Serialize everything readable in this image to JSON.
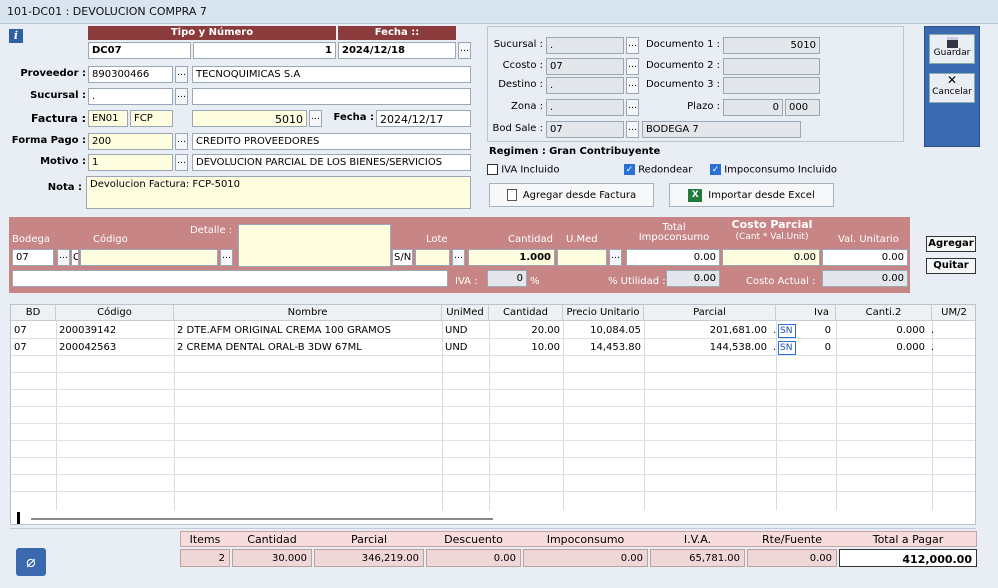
{
  "window": {
    "title": "101-DC01 : DEVOLUCION COMPRA 7"
  },
  "header": {
    "tipo_numero_label": "Tipo y Número",
    "fecha_label": "Fecha ::",
    "tipo": "DC07",
    "numero": "1",
    "fecha": "2024/12/18",
    "proveedor_label": "Proveedor :",
    "proveedor_code": "890300466",
    "proveedor_name": "TECNOQUIMICAS S.A",
    "sucursal_label": "Sucursal :",
    "sucursal_value": ".",
    "sucursal_name": "",
    "factura_label": "Factura :",
    "factura_pref": "EN01",
    "factura_tipo": "FCP",
    "factura_num": "5010",
    "factura_fecha_label": "Fecha :",
    "factura_fecha": "2024/12/17",
    "forma_pago_label": "Forma Pago :",
    "forma_pago_code": "200",
    "forma_pago_name": "CREDITO PROVEEDORES",
    "motivo_label": "Motivo :",
    "motivo_code": "1",
    "motivo_name": "DEVOLUCION PARCIAL DE LOS BIENES/SERVICIOS",
    "nota_label": "Nota :",
    "nota": "Devolucion Factura: FCP-5010"
  },
  "right": {
    "sucursal_label": "Sucursal :",
    "sucursal": ".",
    "ccosto_label": "Ccosto :",
    "ccosto": "07",
    "destino_label": "Destino :",
    "destino": ".",
    "zona_label": "Zona :",
    "zona": ".",
    "bodsale_label": "Bod Sale :",
    "bodsale": "07",
    "bodsale_name": "BODEGA 7",
    "doc1_label": "Documento 1 :",
    "doc1": "5010",
    "doc2_label": "Documento 2 :",
    "doc2": "",
    "doc3_label": "Documento 3 :",
    "doc3": "",
    "plazo_label": "Plazo :",
    "plazo1": "0",
    "plazo2": "000",
    "regimen_label": "Regimen :",
    "regimen": "Gran Contribuyente",
    "iva_incluido": "IVA Incluido",
    "redondear": "Redondear",
    "impoconsumo": "Impoconsumo Incluido",
    "agregar_factura": "Agregar desde Factura",
    "importar_excel": "Importar desde Excel"
  },
  "actions": {
    "guardar": "Guardar",
    "cancelar": "Cancelar"
  },
  "entry": {
    "bodega_label": "Bodega",
    "codigo_label": "Código",
    "detalle_label": "Detalle :",
    "lote_label": "Lote",
    "cantidad_label": "Cantidad",
    "umed_label": "U.Med",
    "total_impo_label1": "Total",
    "total_impo_label2": "Impoconsumo",
    "costo_parcial_label": "Costo Parcial",
    "costo_parcial_sub": "(Cant * Val.Unit)",
    "val_unit_label": "Val. Unitario",
    "bodega": "07",
    "codigo": "C",
    "sn": "S/N",
    "cantidad": "1.000",
    "total_impo": "0.00",
    "costo_parcial": "0.00",
    "val_unit": "0.00",
    "iva_label": "IVA :",
    "iva": "0",
    "pct": "%",
    "utilidad_label": "% Utilidad :",
    "utilidad": "0.00",
    "costo_actual_label": "Costo Actual :",
    "costo_actual": "0.00",
    "agregar": "Agregar",
    "quitar": "Quitar"
  },
  "grid": {
    "columns": [
      "BD",
      "Código",
      "Nombre",
      "UniMed",
      "Cantidad",
      "Precio Unitario",
      "Parcial",
      "Iva",
      "Canti.2",
      "UM/2"
    ],
    "rows": [
      {
        "bd": "07",
        "codigo": "200039142",
        "nombre": "2 DTE.AFM ORIGINAL CREMA 100 GRAMOS",
        "unimed": "UND",
        "cantidad": "20.00",
        "precio": "10,084.05",
        "parcial": "201,681.00",
        "flag": ".",
        "sn": "SN",
        "iva": "0",
        "canti2": "0.000",
        "um2": "."
      },
      {
        "bd": "07",
        "codigo": "200042563",
        "nombre": "2 CREMA DENTAL ORAL-B 3DW 67ML",
        "unimed": "UND",
        "cantidad": "10.00",
        "precio": "14,453.80",
        "parcial": "144,538.00",
        "flag": ".",
        "sn": "SN",
        "iva": "0",
        "canti2": "0.000",
        "um2": "."
      }
    ]
  },
  "totals": {
    "labels": [
      "Items",
      "Cantidad",
      "Parcial",
      "Descuento",
      "Impoconsumo",
      "I.V.A.",
      "Rte/Fuente",
      "Total a Pagar"
    ],
    "values": [
      "2",
      "30.000",
      "346,219.00",
      "0.00",
      "0.00",
      "65,781.00",
      "0.00",
      "412,000.00"
    ]
  }
}
